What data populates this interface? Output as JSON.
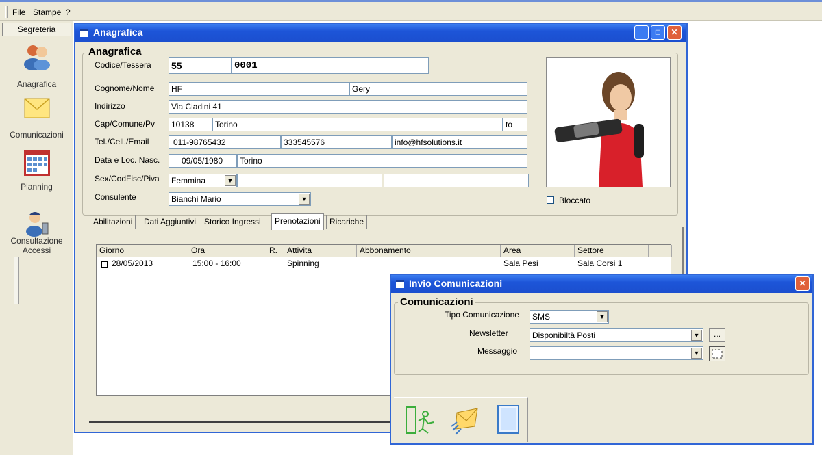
{
  "menu": [
    "File",
    "Stampe",
    "?"
  ],
  "sidebar": {
    "header": "Segreteria",
    "items": [
      {
        "label": "Anagrafica",
        "icon": "user-group-icon"
      },
      {
        "label": "Comunicazioni",
        "icon": "envelope-icon"
      },
      {
        "label": "Planning",
        "icon": "calendar-grid-icon"
      },
      {
        "label": "Consultazione Accessi",
        "icon": "user-access-icon"
      }
    ]
  },
  "anagrafica": {
    "title": "Anagrafica",
    "group_title": "Anagrafica",
    "labels": {
      "codice": "Codice/Tessera",
      "cognome": "Cognome/Nome",
      "indirizzo": "Indirizzo",
      "cap": "Cap/Comune/Pv",
      "tel": "Tel./Cell./Email",
      "nascita": "Data e Loc. Nasc.",
      "sex": "Sex/CodFisc/Piva",
      "consulente": "Consulente",
      "bloccato": "Bloccato"
    },
    "values": {
      "codice1": "55",
      "codice2": "0001",
      "cognome": "HF",
      "nome": "Gery",
      "indirizzo": "Via Ciadini 41",
      "cap": "10138",
      "comune": "Torino",
      "pv": "to",
      "tel": "011-98765432",
      "cell": "333545576",
      "email": "info@hfsolutions.it",
      "data_nasc": "09/05/1980",
      "loc_nasc": "Torino",
      "sex": "Femmina",
      "codfisc": "",
      "piva": "",
      "consulente": "Bianchi Mario"
    },
    "tabs": [
      "Abilitazioni",
      "Dati Aggiuntivi",
      "Storico Ingressi",
      "Prenotazioni",
      "Ricariche"
    ],
    "active_tab": "Prenotazioni",
    "columns": [
      "Giorno",
      "Ora",
      "R.",
      "Attivita",
      "Abbonamento",
      "Area",
      "Settore"
    ],
    "rows": [
      {
        "giorno": "28/05/2013",
        "ora": "15:00 - 16:00",
        "r": "",
        "attivita": "Spinning",
        "abbonamento": "",
        "area": "Sala Pesi",
        "settore": "Sala Corsi 1"
      }
    ]
  },
  "invio": {
    "title": "Invio Comunicazioni",
    "group_title": "Comunicazioni",
    "labels": {
      "tipo": "Tipo Comunicazione",
      "newsletter": "Newsletter",
      "messaggio": "Messaggio"
    },
    "values": {
      "tipo": "SMS",
      "newsletter": "Disponibiltà Posti",
      "messaggio": "",
      "browse": "..."
    }
  },
  "colors": {
    "titlebar": "#1d55d8",
    "window_bg": "#ece9d8",
    "close": "#e0613b"
  }
}
